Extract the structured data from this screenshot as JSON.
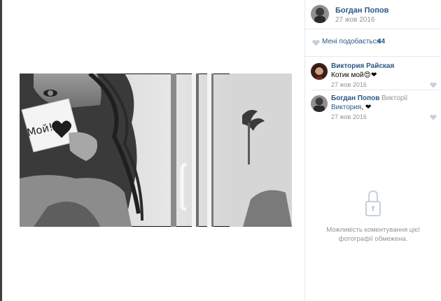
{
  "author": {
    "name": "Богдан Попов",
    "date": "27 жов 2016",
    "avatar_icon": "avatar-icon"
  },
  "likes": {
    "label": "Мені подобається",
    "count": "44",
    "icon": "heart-icon"
  },
  "comments": [
    {
      "author": "Виктория Райская",
      "text": "Котик мой",
      "emoji": "😍❤",
      "date": "27 жов 2016"
    },
    {
      "author": "Богдан Попов",
      "reply_to": "Викторії",
      "mention": "Виктория",
      "emoji": "❤",
      "date": "27 жов 2016"
    }
  ],
  "restricted": {
    "text": "Можливість коментування цієї фотографії обмежена.",
    "icon": "lock-icon"
  },
  "photo": {
    "note_text": "Мой!",
    "colors": {
      "bg": "#d9d9d9",
      "dark": "#1e1e1e"
    }
  },
  "colors": {
    "link": "#2a5885",
    "muted": "#939393",
    "divider": "#e7e8ec",
    "heart_red": "#e64646",
    "heart_gray": "#c5d0db"
  }
}
